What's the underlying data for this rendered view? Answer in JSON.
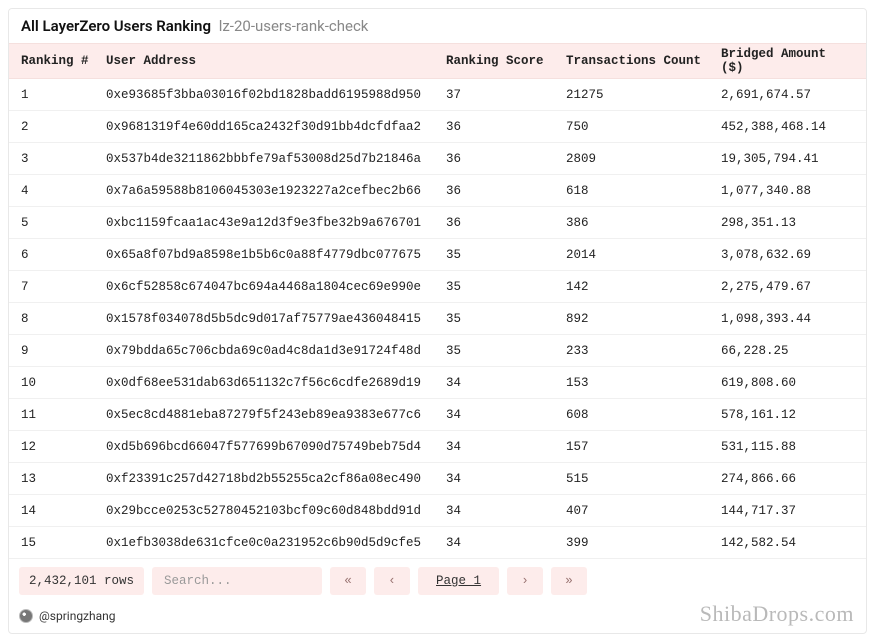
{
  "title": "All LayerZero Users Ranking",
  "subtitle": "lz-20-users-rank-check",
  "columns": {
    "rank": "Ranking #",
    "addr": "User Address",
    "score": "Ranking Score",
    "tx": "Transactions Count",
    "amt": "Bridged Amount ($)"
  },
  "rows": [
    {
      "rank": "1",
      "addr": "0xe93685f3bba03016f02bd1828badd6195988d950",
      "score": "37",
      "tx": "21275",
      "amt": "2,691,674.57"
    },
    {
      "rank": "2",
      "addr": "0x9681319f4e60dd165ca2432f30d91bb4dcfdfaa2",
      "score": "36",
      "tx": "750",
      "amt": "452,388,468.14"
    },
    {
      "rank": "3",
      "addr": "0x537b4de3211862bbbfe79af53008d25d7b21846a",
      "score": "36",
      "tx": "2809",
      "amt": "19,305,794.41"
    },
    {
      "rank": "4",
      "addr": "0x7a6a59588b8106045303e1923227a2cefbec2b66",
      "score": "36",
      "tx": "618",
      "amt": "1,077,340.88"
    },
    {
      "rank": "5",
      "addr": "0xbc1159fcaa1ac43e9a12d3f9e3fbe32b9a676701",
      "score": "36",
      "tx": "386",
      "amt": "298,351.13"
    },
    {
      "rank": "6",
      "addr": "0x65a8f07bd9a8598e1b5b6c0a88f4779dbc077675",
      "score": "35",
      "tx": "2014",
      "amt": "3,078,632.69"
    },
    {
      "rank": "7",
      "addr": "0x6cf52858c674047bc694a4468a1804cec69e990e",
      "score": "35",
      "tx": "142",
      "amt": "2,275,479.67"
    },
    {
      "rank": "8",
      "addr": "0x1578f034078d5b5dc9d017af75779ae436048415",
      "score": "35",
      "tx": "892",
      "amt": "1,098,393.44"
    },
    {
      "rank": "9",
      "addr": "0x79bdda65c706cbda69c0ad4c8da1d3e91724f48d",
      "score": "35",
      "tx": "233",
      "amt": "66,228.25"
    },
    {
      "rank": "10",
      "addr": "0x0df68ee531dab63d651132c7f56c6cdfe2689d19",
      "score": "34",
      "tx": "153",
      "amt": "619,808.60"
    },
    {
      "rank": "11",
      "addr": "0x5ec8cd4881eba87279f5f243eb89ea9383e677c6",
      "score": "34",
      "tx": "608",
      "amt": "578,161.12"
    },
    {
      "rank": "12",
      "addr": "0xd5b696bcd66047f577699b67090d75749beb75d4",
      "score": "34",
      "tx": "157",
      "amt": "531,115.88"
    },
    {
      "rank": "13",
      "addr": "0xf23391c257d42718bd2b55255ca2cf86a08ec490",
      "score": "34",
      "tx": "515",
      "amt": "274,866.66"
    },
    {
      "rank": "14",
      "addr": "0x29bcce0253c52780452103bcf09c60d848bdd91d",
      "score": "34",
      "tx": "407",
      "amt": "144,717.37"
    },
    {
      "rank": "15",
      "addr": "0x1efb3038de631cfce0c0a231952c6b90d5d9cfe5",
      "score": "34",
      "tx": "399",
      "amt": "142,582.54"
    }
  ],
  "footer": {
    "rowcount": "2,432,101 rows",
    "search_placeholder": "Search...",
    "first": "«",
    "prev": "‹",
    "page": "Page 1",
    "next": "›",
    "last": "»"
  },
  "author": "@springzhang",
  "watermark": "ShibaDrops.com"
}
